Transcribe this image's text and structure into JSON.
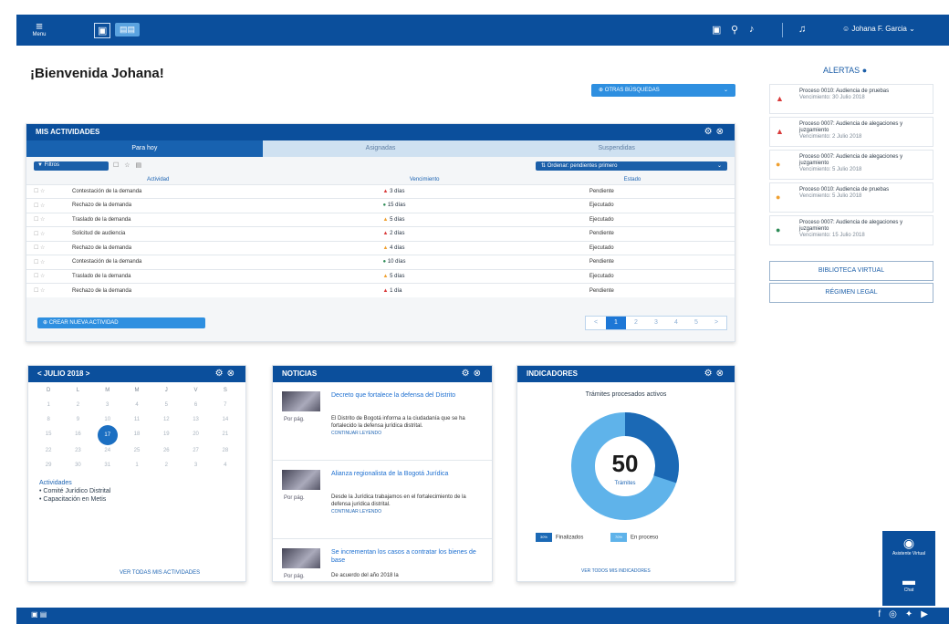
{
  "header": {
    "menu_label": "Menu",
    "user_name": "Johana F. Garcia"
  },
  "welcome": "¡Bienvenida Johana!",
  "search_pill": "OTRAS BÚSQUEDAS",
  "activities": {
    "title": "MIS ACTIVIDADES",
    "tabs": [
      "Para hoy",
      "Asignadas",
      "Suspendidas"
    ],
    "filter_label": "Filtros",
    "order_label": "Ordenar: pendientes primero",
    "columns": [
      "Actividad",
      "Vencimiento",
      "Estado"
    ],
    "rows": [
      {
        "activity": "Contestación de la demanda",
        "due": "3 días",
        "icon": "alert",
        "status": "Pendiente"
      },
      {
        "activity": "Rechazo de la demanda",
        "due": "15 días",
        "icon": "green",
        "status": "Ejecutado"
      },
      {
        "activity": "Traslado de la demanda",
        "due": "5 días",
        "icon": "orange",
        "status": "Ejecutado"
      },
      {
        "activity": "Solicitud de audiencia",
        "due": "2 días",
        "icon": "alert",
        "status": "Pendiente"
      },
      {
        "activity": "Rechazo de la demanda",
        "due": "4 días",
        "icon": "orange",
        "status": "Ejecutado"
      },
      {
        "activity": "Contestación de la demanda",
        "due": "10 días",
        "icon": "green",
        "status": "Pendiente"
      },
      {
        "activity": "Traslado de la demanda",
        "due": "5 días",
        "icon": "orange",
        "status": "Ejecutado"
      },
      {
        "activity": "Rechazo de la demanda",
        "due": "1 día",
        "icon": "alert",
        "status": "Pendiente"
      }
    ],
    "new_activity": "CREAR NUEVA ACTIVIDAD",
    "pages": [
      "<",
      "1",
      "2",
      "3",
      "4",
      "5",
      ">"
    ]
  },
  "alerts": {
    "title": "ALERTAS",
    "items": [
      {
        "icon": "alert",
        "title": "Proceso 0010: Audiencia de pruebas",
        "date": "Vencimiento: 30 Julio 2018"
      },
      {
        "icon": "alert",
        "title": "Proceso 0007: Audiencia de alegaciones y juzgamiento",
        "date": "Vencimiento: 2 Julio 2018"
      },
      {
        "icon": "orange",
        "title": "Proceso 0007: Audiencia de alegaciones y juzgamiento",
        "date": "Vencimiento: 5 Julio 2018"
      },
      {
        "icon": "orange",
        "title": "Proceso 0010: Audiencia de pruebas",
        "date": "Vencimiento: 5 Julio 2018"
      },
      {
        "icon": "green",
        "title": "Proceso 0007: Audiencia de alegaciones y juzgamiento",
        "date": "Vencimiento: 15 Julio 2018"
      }
    ],
    "library_button": "BIBLIOTECA VIRTUAL",
    "legal_button": "RÉGIMEN LEGAL"
  },
  "calendar": {
    "title": "< JULIO 2018 >",
    "weekdays": [
      "D",
      "L",
      "M",
      "M",
      "J",
      "V",
      "S"
    ],
    "days": [
      "1",
      "2",
      "3",
      "4",
      "5",
      "6",
      "7",
      "8",
      "9",
      "10",
      "11",
      "12",
      "13",
      "14",
      "15",
      "16",
      "17",
      "18",
      "19",
      "20",
      "21",
      "22",
      "23",
      "24",
      "25",
      "26",
      "27",
      "28",
      "29",
      "30",
      "31",
      "1",
      "2",
      "3",
      "4"
    ],
    "selected": "17",
    "activities_label": "Actividades",
    "activities": [
      "• Comité Jurídico Distrital",
      "• Capacitación en Metis"
    ],
    "more_link": "VER TODAS MIS ACTIVIDADES"
  },
  "news": {
    "title": "NOTICIAS",
    "items": [
      {
        "date": "Por pág.",
        "title": "Decreto que fortalece la defensa del Distrito",
        "body": "El Distrito de Bogotá informa a la ciudadanía que se ha fortalecido la defensa jurídica distrital.",
        "link": "CONTINUAR LEYENDO"
      },
      {
        "date": "Por pág.",
        "title": "Alianza regionalista de la Bogotá Jurídica",
        "body": "Desde la Jurídica trabajamos en el fortalecimiento de la defensa jurídica distrital.",
        "link": "CONTINUAR LEYENDO"
      },
      {
        "date": "Por pág.",
        "title": "Se incrementan los casos a contratar los bienes de base",
        "body": "De acuerdo del año 2018 la",
        "link": ""
      }
    ]
  },
  "indicators": {
    "title": "INDICADORES",
    "subtitle": "Trámites procesados activos",
    "total": "50",
    "total_label": "Trámites",
    "legend": [
      {
        "pct": "30%",
        "label": "Finalizados",
        "color": "#1b69b5"
      },
      {
        "pct": "70%",
        "label": "En proceso",
        "color": "#5fb3ea"
      }
    ],
    "finished_fraction": 0.3,
    "more_link": "VER TODOS MIS INDICADORES"
  },
  "side_widget": {
    "assistant": "Asistente Virtual",
    "chat": "Chat"
  }
}
